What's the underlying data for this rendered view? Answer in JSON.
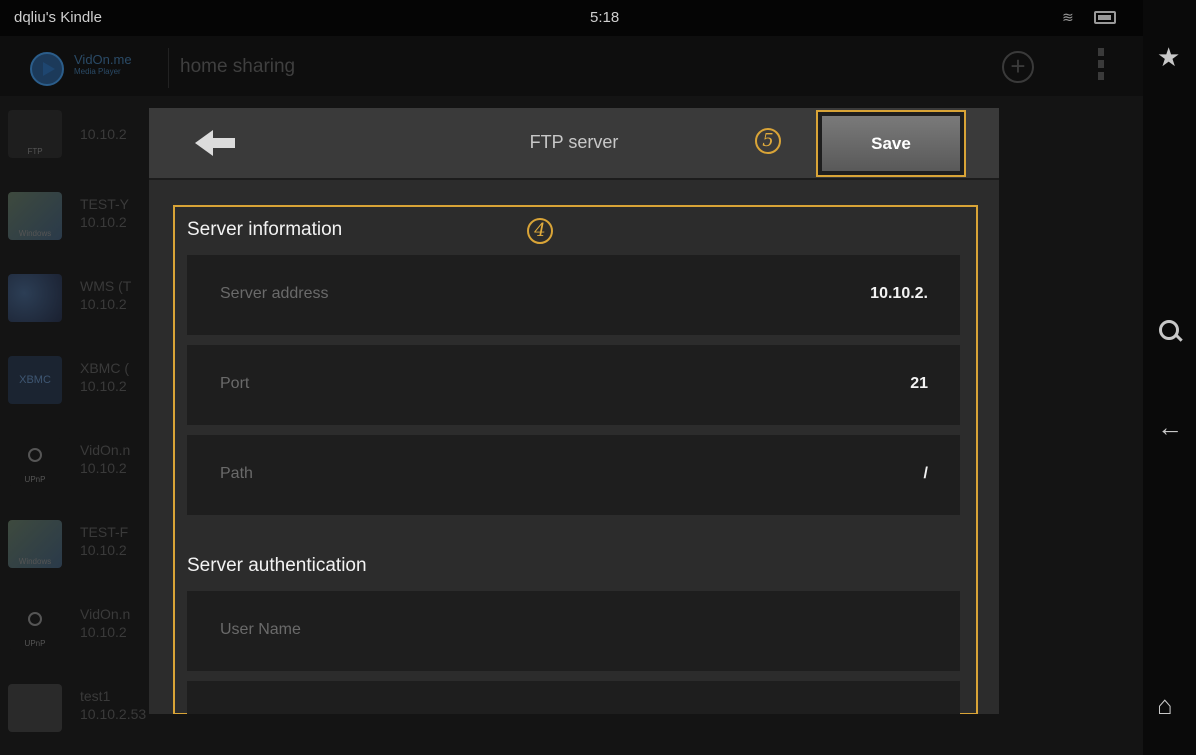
{
  "status_bar": {
    "device_name": "dqliu's Kindle",
    "time": "5:18"
  },
  "app": {
    "brand_name": "VidOn.me",
    "brand_sub": "Media Player",
    "header_title": "home sharing",
    "add_symbol": "+",
    "servers": [
      {
        "name": "",
        "address": "10.10.2",
        "icon_label": "FTP",
        "icon": "ftp-icon"
      },
      {
        "name": "TEST-Y",
        "address": "10.10.2",
        "icon_label": "Windows",
        "icon": "windows-icon"
      },
      {
        "name": "WMS (T",
        "address": "10.10.2",
        "icon_label": "",
        "icon": "wms-icon"
      },
      {
        "name": "XBMC (",
        "address": "10.10.2",
        "icon_label": "XBMC",
        "icon": "xbmc-icon"
      },
      {
        "name": "VidOn.n",
        "address": "10.10.2",
        "icon_label": "UPnP",
        "icon": "upnp-icon"
      },
      {
        "name": "TEST-F",
        "address": "10.10.2",
        "icon_label": "Windows",
        "icon": "windows-icon"
      },
      {
        "name": "VidOn.n",
        "address": "10.10.2",
        "icon_label": "UPnP",
        "icon": "upnp-icon"
      },
      {
        "name": "test1",
        "address": "10.10.2.53",
        "icon_label": "",
        "icon": "usb-drive-icon"
      }
    ]
  },
  "system_bar": {
    "star": "★",
    "back": "🡄",
    "home": "⌂"
  },
  "dialog": {
    "title": "FTP server",
    "save_label": "Save",
    "step5_label": "5",
    "step4_label": "4",
    "server_information": {
      "title": "Server information",
      "fields": [
        {
          "label": "Server address",
          "value": "10.10.2."
        },
        {
          "label": "Port",
          "value": "21"
        },
        {
          "label": "Path",
          "value": "/"
        }
      ]
    },
    "server_authentication": {
      "title": "Server authentication",
      "fields": [
        {
          "label": "User Name",
          "value": ""
        },
        {
          "label": "",
          "value": ""
        }
      ]
    }
  },
  "colors": {
    "highlight": "#d9a437",
    "dialog_bg": "#2c2c2c",
    "field_bg": "#1e1e1e"
  }
}
